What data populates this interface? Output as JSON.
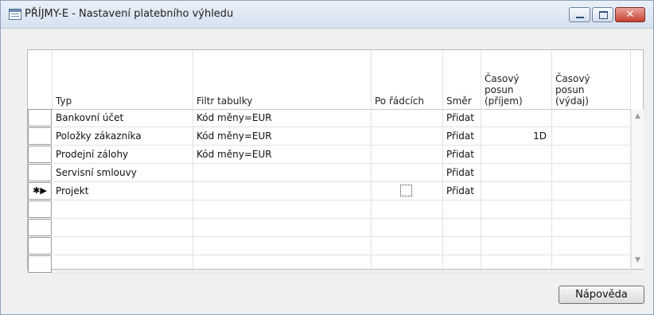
{
  "window": {
    "title": "PŘÍJMY-E - Nastavení platebního výhledu",
    "controls": {
      "minimize": "",
      "maximize": "",
      "close": "✕"
    }
  },
  "table": {
    "columns": [
      "Typ",
      "Filtr tabulky",
      "Po řádcích",
      "Směr",
      "Časový\nposun\n(příjem)",
      "Časový\nposun\n(výdaj)"
    ],
    "rows": [
      {
        "typ": "Bankovní účet",
        "filtr": "Kód měny=EUR",
        "po_radcich": "",
        "smer": "Přidat",
        "prijem": "",
        "vydaj": ""
      },
      {
        "typ": "Položky zákazníka",
        "filtr": "Kód měny=EUR",
        "po_radcich": "",
        "smer": "Přidat",
        "prijem": "1D",
        "vydaj": ""
      },
      {
        "typ": "Prodejní zálohy",
        "filtr": "Kód měny=EUR",
        "po_radcich": "",
        "smer": "Přidat",
        "prijem": "",
        "vydaj": ""
      },
      {
        "typ": "Servisní smlouvy",
        "filtr": "",
        "po_radcich": "",
        "smer": "Přidat",
        "prijem": "",
        "vydaj": ""
      },
      {
        "typ": "Projekt",
        "filtr": "",
        "po_radcich": "",
        "smer": "Přidat",
        "prijem": "",
        "vydaj": ""
      }
    ],
    "current_row_marker": "✱▶",
    "empty_rows": 4
  },
  "footer": {
    "help_label": "Nápověda"
  },
  "icons": {
    "window_icon": "table-form-icon",
    "scroll_up": "▲",
    "scroll_down": "▼"
  }
}
